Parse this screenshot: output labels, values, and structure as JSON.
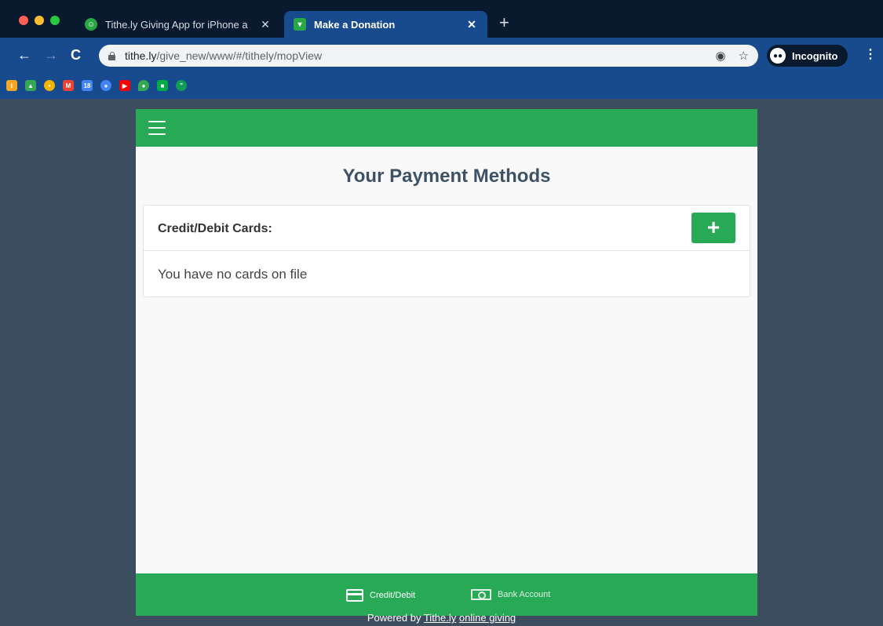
{
  "browser": {
    "tabs": [
      {
        "title": "Tithe.ly Giving App for iPhone a",
        "close": "✕"
      },
      {
        "title": "Make a Donation",
        "close": "✕"
      }
    ],
    "new_tab": "+",
    "nav": {
      "back": "←",
      "forward": "→",
      "reload": "C"
    },
    "url": {
      "host": "tithe.ly",
      "path": "/give_new/www/#/tithely/mopView"
    },
    "omnibox_icons": {
      "location": "◉",
      "star": "☆"
    },
    "incognito_label": "Incognito",
    "menu": "⋮",
    "bookmarks": [
      {
        "icon": "bookmark-icon",
        "color": "#f5a623",
        "glyph": "t"
      },
      {
        "icon": "drive-icon",
        "color": "#34a853",
        "glyph": "▲"
      },
      {
        "icon": "compass-icon",
        "color": "#f4b400",
        "glyph": "•"
      },
      {
        "icon": "gmail-icon",
        "color": "#ea4335",
        "glyph": "M"
      },
      {
        "icon": "calendar-icon",
        "color": "#4285f4",
        "glyph": "18"
      },
      {
        "icon": "contacts-icon",
        "color": "#4285f4",
        "glyph": "●"
      },
      {
        "icon": "youtube-icon",
        "color": "#ff0000",
        "glyph": "▶"
      },
      {
        "icon": "maps-icon",
        "color": "#34a853",
        "glyph": "●"
      },
      {
        "icon": "meet-icon",
        "color": "#00ac47",
        "glyph": "■"
      },
      {
        "icon": "hangouts-icon",
        "color": "#0f9d58",
        "glyph": "”"
      }
    ]
  },
  "app": {
    "page_title": "Your Payment Methods",
    "cards_section": {
      "label": "Credit/Debit Cards:",
      "add_button": "+",
      "empty_message": "You have no cards on file"
    },
    "footer": {
      "credit_label": "Credit/Debit",
      "bank_label": "Bank Account"
    },
    "powered": {
      "prefix": "Powered by ",
      "link1": "Tithe.ly",
      "link2": "online giving"
    }
  }
}
